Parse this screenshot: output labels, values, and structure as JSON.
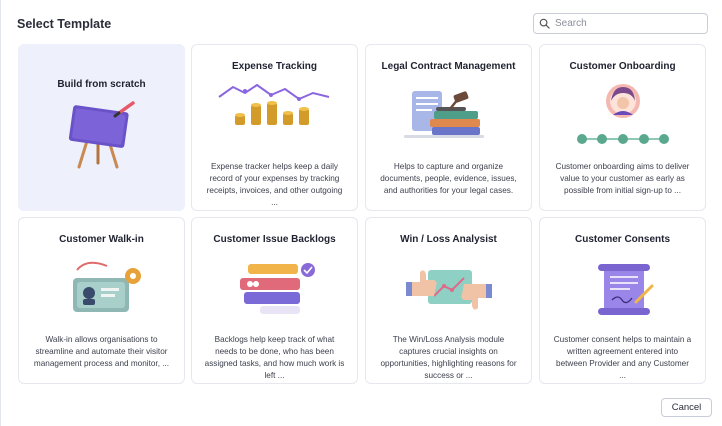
{
  "dialog": {
    "title": "Select Template"
  },
  "search": {
    "placeholder": "Search",
    "value": ""
  },
  "templates": [
    {
      "name": "Build from scratch",
      "description": "",
      "icon": "easel-paintbrush-icon"
    },
    {
      "name": "Expense Tracking",
      "description": "Expense tracker helps keep a daily record of your expenses by tracking receipts, invoices, and other outgoing ...",
      "icon": "coin-stacks-graph-icon"
    },
    {
      "name": "Legal Contract Management",
      "description": "Helps to capture and organize documents, people, evidence, issues, and authorities for your legal cases.",
      "icon": "gavel-books-icon"
    },
    {
      "name": "Customer Onboarding",
      "description": "Customer onboarding aims to deliver value to your customer as early as possible from initial sign-up to ...",
      "icon": "avatar-progress-steps-icon"
    },
    {
      "name": "Customer Walk-in",
      "description": "Walk-in allows organisations to streamline and automate their visitor management process and monitor, ...",
      "icon": "id-badge-gear-icon"
    },
    {
      "name": "Customer Issue Backlogs",
      "description": "Backlogs help keep track of what needs to be done, who has been assigned tasks, and how much work is left ...",
      "icon": "stacked-tasks-icon"
    },
    {
      "name": "Win / Loss Analysist",
      "description": "The Win/Loss Analysis module captures crucial insights on opportunities, highlighting reasons for success or ...",
      "icon": "thumbs-up-down-icon"
    },
    {
      "name": "Customer Consents",
      "description": "Customer consent helps to maintain a written agreement entered into between Provider and any Customer ...",
      "icon": "signed-scroll-icon"
    }
  ],
  "footer": {
    "cancel_label": "Cancel"
  }
}
